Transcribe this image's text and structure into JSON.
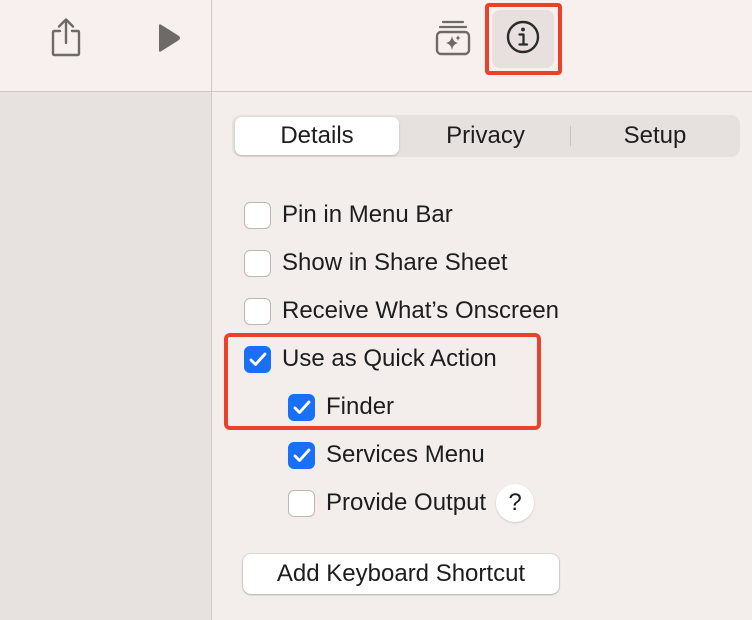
{
  "toolbar": {
    "icons": {
      "share": "share-icon",
      "run": "play-icon",
      "library": "action-library-icon",
      "info": "info-icon"
    }
  },
  "tabs": [
    {
      "label": "Details",
      "selected": true
    },
    {
      "label": "Privacy",
      "selected": false
    },
    {
      "label": "Setup",
      "selected": false
    }
  ],
  "options": {
    "pin_menu_bar": {
      "label": "Pin in Menu Bar",
      "checked": false
    },
    "share_sheet": {
      "label": "Show in Share Sheet",
      "checked": false
    },
    "receive_onscreen": {
      "label": "Receive What’s Onscreen",
      "checked": false
    },
    "quick_action": {
      "label": "Use as Quick Action",
      "checked": true
    },
    "finder": {
      "label": "Finder",
      "checked": true
    },
    "services_menu": {
      "label": "Services Menu",
      "checked": true
    },
    "provide_output": {
      "label": "Provide Output",
      "checked": false
    }
  },
  "help_label": "?",
  "shortcut_button_label": "Add Keyboard Shortcut",
  "colors": {
    "accent": "#1a6ff7",
    "highlight": "#e9412c"
  }
}
